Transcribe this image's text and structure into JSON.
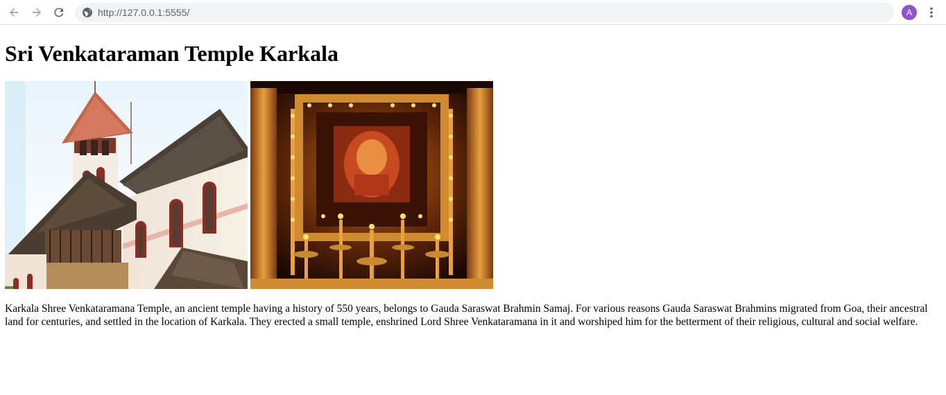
{
  "browser": {
    "url": "http://127.0.0.1:5555/",
    "profile_initial": "A",
    "profile_color": "#8e55c8"
  },
  "page": {
    "title": "Sri Venkataraman Temple Karkala",
    "images": [
      {
        "name": "temple-exterior-photo",
        "alt": ""
      },
      {
        "name": "temple-deity-shrine-photo",
        "alt": ""
      }
    ],
    "description": "Karkala Shree Venkataramana Temple, an ancient temple having a history of 550 years, belongs to Gauda Saraswat Brahmin Samaj. For various reasons Gauda Saraswat Brahmins migrated from Goa, their ancestral land for centuries, and settled in the location of Karkala. They erected a small temple, enshrined Lord Shree Venkataramana in it and worshiped him for the betterment of their religious, cultural and social welfare."
  }
}
